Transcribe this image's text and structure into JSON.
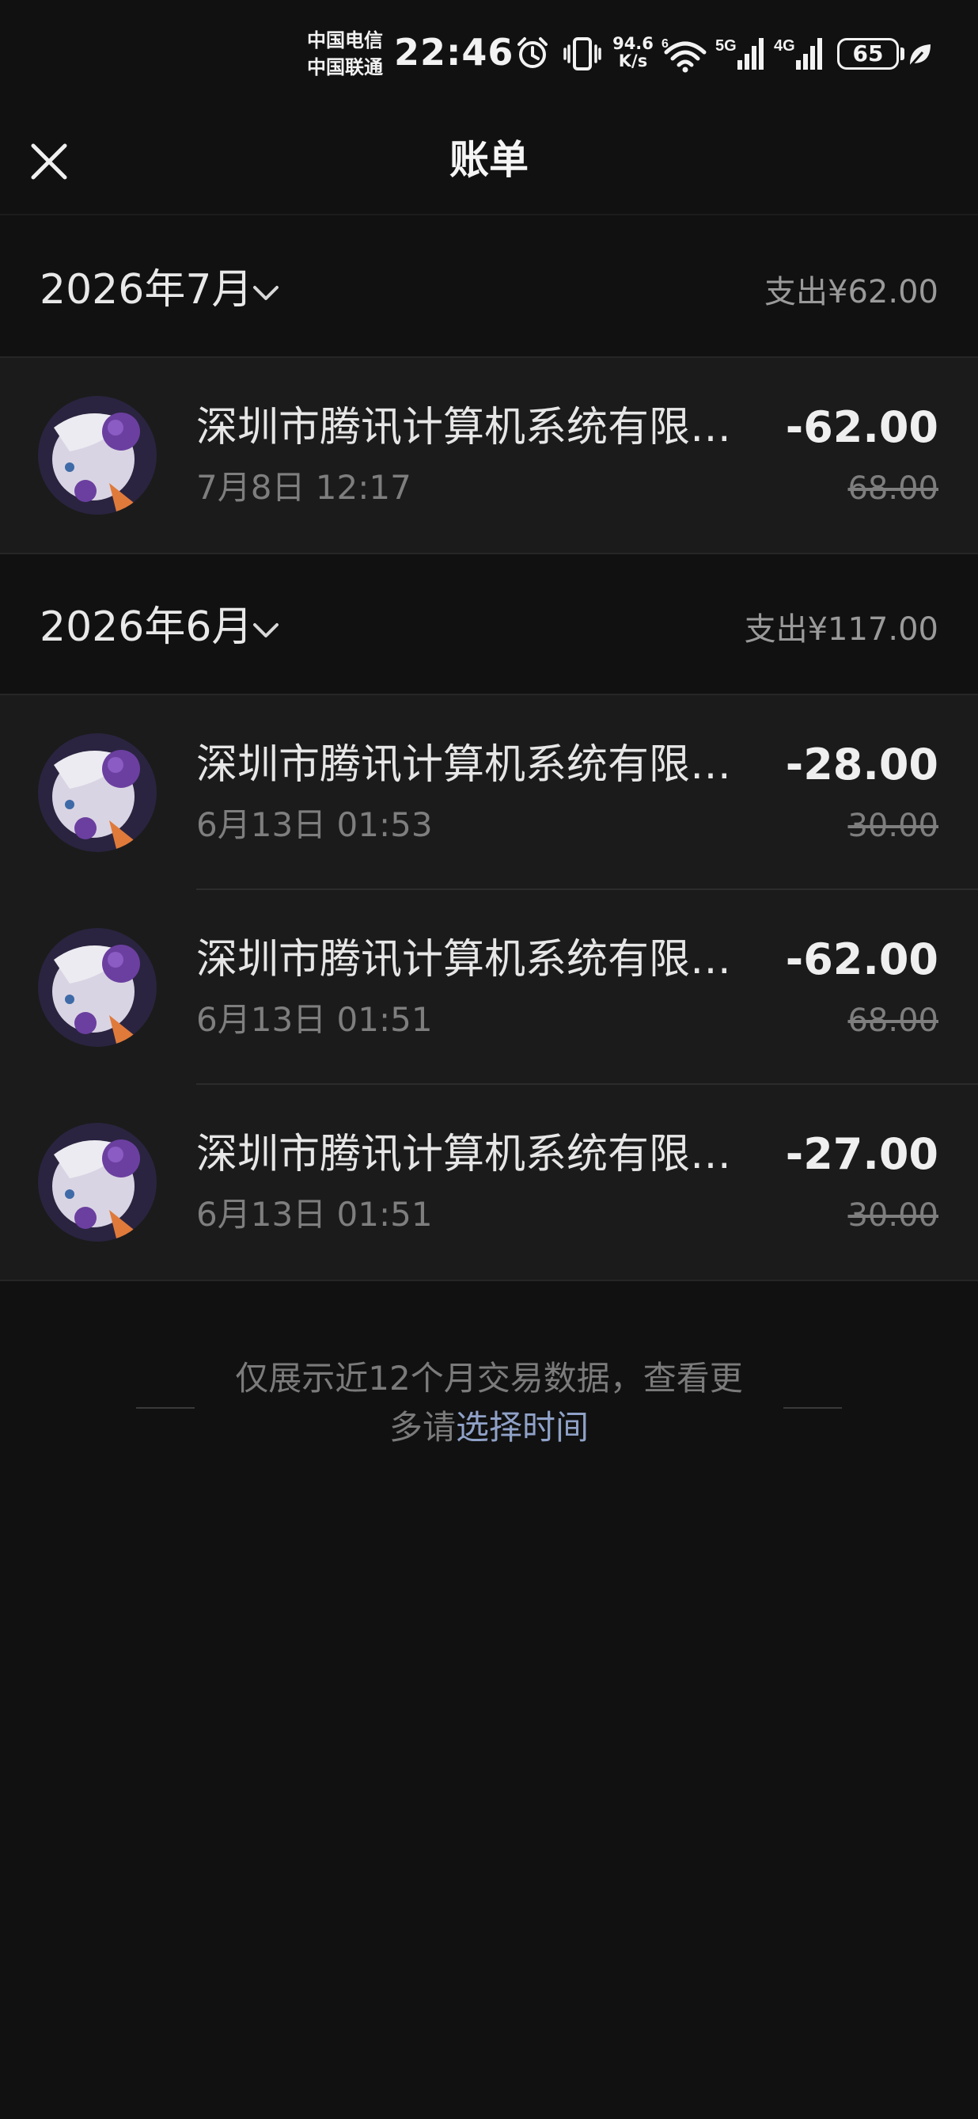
{
  "status_bar": {
    "carrier_1": "中国电信",
    "carrier_2": "中国联通",
    "time": "22:46",
    "net_speed_value": "94.6",
    "net_speed_unit": "K/s",
    "wifi_badge": "6",
    "sim1_network": "5G",
    "sim2_network": "4G",
    "battery": "65",
    "icons": [
      "alarm-icon",
      "vibrate-icon",
      "wifi-icon",
      "signal-5g-icon",
      "signal-4g-icon",
      "battery-icon",
      "leaf-icon"
    ]
  },
  "header": {
    "title": "账单",
    "close_icon": "close-icon"
  },
  "months": [
    {
      "label": "2026年7月",
      "expense": "支出¥62.00",
      "transactions": [
        {
          "name": "深圳市腾讯计算机系统有限…",
          "time": "7月8日 12:17",
          "amount": "-62.00",
          "original": "68.00"
        }
      ]
    },
    {
      "label": "2026年6月",
      "expense": "支出¥117.00",
      "transactions": [
        {
          "name": "深圳市腾讯计算机系统有限…",
          "time": "6月13日 01:53",
          "amount": "-28.00",
          "original": "30.00"
        },
        {
          "name": "深圳市腾讯计算机系统有限…",
          "time": "6月13日 01:51",
          "amount": "-62.00",
          "original": "68.00"
        },
        {
          "name": "深圳市腾讯计算机系统有限…",
          "time": "6月13日 01:51",
          "amount": "-27.00",
          "original": "30.00"
        }
      ]
    }
  ],
  "footer": {
    "line1": "仅展示近12个月交易数据，查看更",
    "line2_prefix": "多请",
    "link_text": "选择时间"
  },
  "colors": {
    "background": "#111111",
    "row_background": "#1b1b1b",
    "link": "#8fa1c7",
    "avatar_accent": "#6b3fa0"
  }
}
